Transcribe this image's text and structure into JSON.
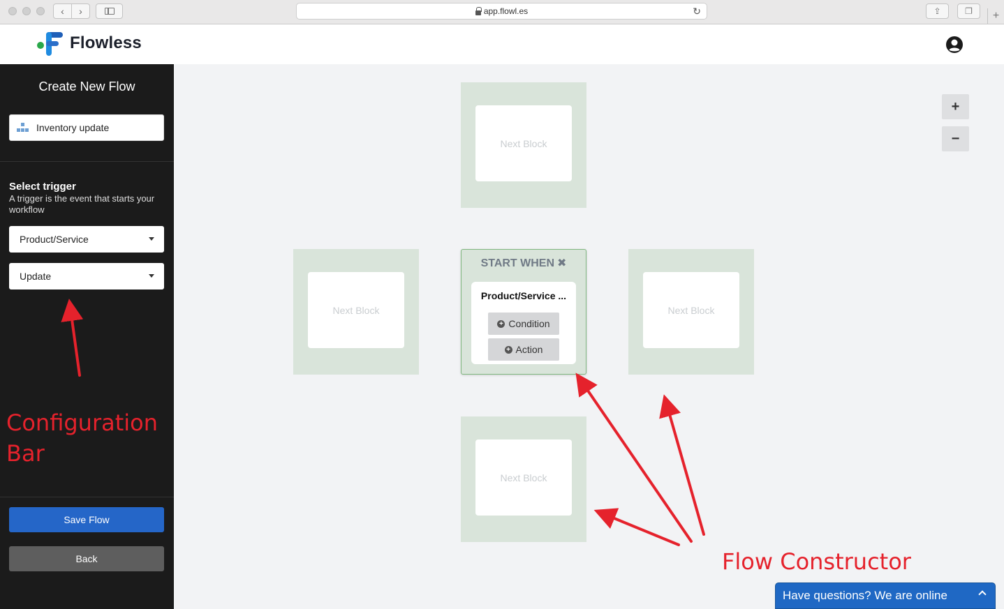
{
  "browser": {
    "url": "app.flowl.es"
  },
  "brand": {
    "name": "Flowless"
  },
  "sidebar": {
    "title": "Create New Flow",
    "flow_name": "Inventory update",
    "trigger_heading": "Select trigger",
    "trigger_description": "A trigger is the event that starts your workflow",
    "trigger_entity": "Product/Service",
    "trigger_event": "Update",
    "save_label": "Save Flow",
    "back_label": "Back"
  },
  "canvas": {
    "zoom_in": "+",
    "zoom_out": "−",
    "next_block_label": "Next Block",
    "start": {
      "title": "START WHEN",
      "close": "✖",
      "trigger_label": "Product/Service ...",
      "condition_label": "Condition",
      "action_label": "Action"
    }
  },
  "annotations": {
    "config_bar_line1": "Configuration",
    "config_bar_line2": "Bar",
    "flow_constructor": "Flow Constructor"
  },
  "chat": {
    "label": "Have questions? We are online"
  },
  "colors": {
    "sidebar_bg": "#1b1b1b",
    "primary": "#2566c8",
    "slot_green": "#d9e4da",
    "annotation_red": "#e5222c"
  }
}
